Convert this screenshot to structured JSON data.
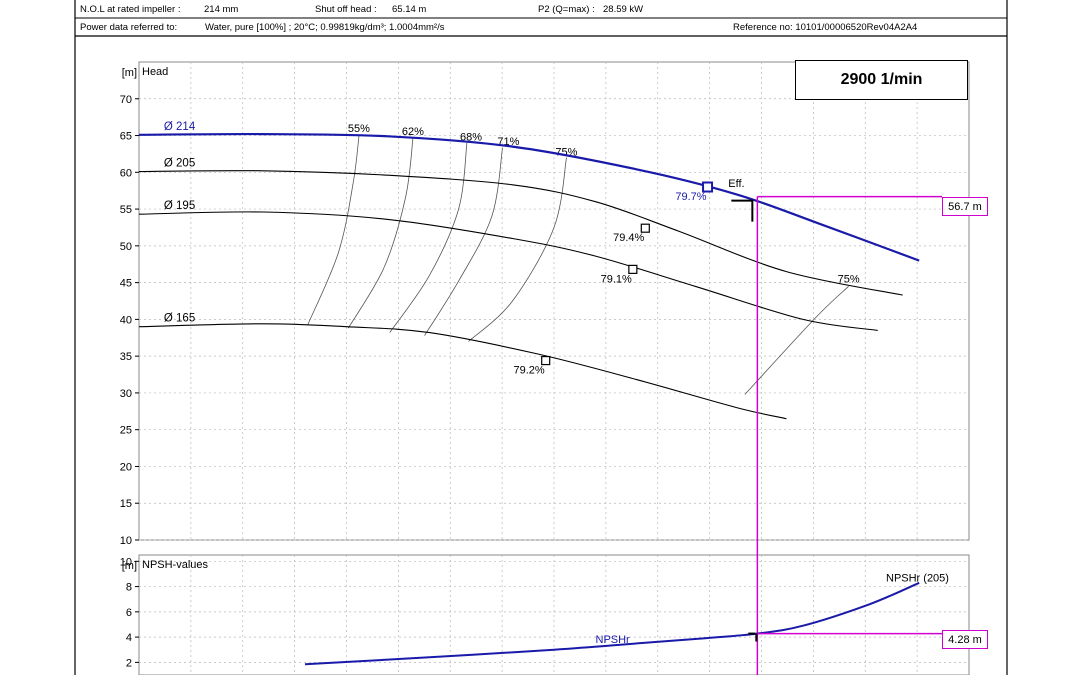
{
  "header": {
    "npol_label": "N.O.L at rated impeller :",
    "npol_value": "214 mm",
    "shutoff_label": "Shut off head :",
    "shutoff_value": "65.14 m",
    "p2_label": "P2 (Q=max) :",
    "p2_value": "28.59 kW",
    "power_label": "Power data referred to:",
    "power_value": "Water, pure [100%] ; 20°C; 0.99819kg/dm³; 1.0004mm²/s",
    "reference": "Reference no: 10101/00006520Rev04A2A4"
  },
  "speed_label": "2900 1/min",
  "callouts": {
    "head": "56.7 m",
    "npsh": "4.28 m"
  },
  "colors": {
    "operating_curve": "#1a1aaa",
    "duty_lines": "#d000d0",
    "grid": "#b8b8b8",
    "curves": "#000000"
  },
  "chart_data": [
    {
      "type": "line",
      "title": "Head",
      "ylabel": "[m]",
      "ylim": [
        10,
        75
      ],
      "xlim": [
        0,
        100
      ],
      "yticks": [
        10,
        15,
        20,
        25,
        30,
        35,
        40,
        45,
        50,
        55,
        60,
        65,
        70
      ],
      "grid": true,
      "series": [
        {
          "name": "Ø 214",
          "highlight": true,
          "points": [
            [
              0,
              65.1
            ],
            [
              15,
              65.2
            ],
            [
              30,
              64.9
            ],
            [
              45,
              63.5
            ],
            [
              60,
              60.4
            ],
            [
              72,
              57.0
            ],
            [
              82,
              53.0
            ],
            [
              94,
              48.0
            ]
          ],
          "bep": [
            68.5,
            58.0
          ],
          "bep_label": "79.7%"
        },
        {
          "name": "Ø 205",
          "points": [
            [
              0,
              60.1
            ],
            [
              15,
              60.2
            ],
            [
              30,
              59.6
            ],
            [
              45,
              58.3
            ],
            [
              55,
              56.0
            ],
            [
              65,
              52.0
            ],
            [
              78,
              46.5
            ],
            [
              92,
              43.3
            ]
          ],
          "bep": [
            61,
            52.4
          ],
          "bep_label": "79.4%"
        },
        {
          "name": "Ø 195",
          "points": [
            [
              0,
              54.3
            ],
            [
              15,
              54.6
            ],
            [
              30,
              53.6
            ],
            [
              45,
              51.0
            ],
            [
              55,
              48.6
            ],
            [
              67,
              44.5
            ],
            [
              80,
              40.0
            ],
            [
              89,
              38.5
            ]
          ],
          "bep": [
            59.5,
            46.8
          ],
          "bep_label": "79.1%"
        },
        {
          "name": "Ø 165",
          "points": [
            [
              0,
              39.0
            ],
            [
              15,
              39.4
            ],
            [
              25,
              39.0
            ],
            [
              35,
              38.2
            ],
            [
              48,
              35.3
            ],
            [
              60,
              31.8
            ],
            [
              72,
              28.0
            ],
            [
              78,
              26.5
            ]
          ],
          "bep": [
            49,
            34.4
          ],
          "bep_label": "79.2%"
        }
      ],
      "efficiency_labels": [
        {
          "label": "55%",
          "at": [
            26.5,
            65.5
          ]
        },
        {
          "label": "62%",
          "at": [
            33,
            65.1
          ]
        },
        {
          "label": "68%",
          "at": [
            40,
            64.3
          ]
        },
        {
          "label": "71%",
          "at": [
            44.5,
            63.7
          ]
        },
        {
          "label": "75%",
          "at": [
            51.5,
            62.3
          ]
        },
        {
          "label": "75%",
          "at": [
            85.5,
            45.0
          ]
        }
      ],
      "efficiency_lines": [
        [
          [
            26.5,
            65.0
          ],
          [
            25.8,
            58.5
          ],
          [
            24,
            49
          ],
          [
            20.3,
            39.2
          ]
        ],
        [
          [
            33,
            64.6
          ],
          [
            32.1,
            56.5
          ],
          [
            29.5,
            47
          ],
          [
            25.2,
            38.8
          ]
        ],
        [
          [
            39.5,
            64.0
          ],
          [
            38.5,
            55
          ],
          [
            35,
            46
          ],
          [
            30.2,
            38.2
          ]
        ],
        [
          [
            43.8,
            63.3
          ],
          [
            42.5,
            54
          ],
          [
            38.5,
            45.2
          ],
          [
            34.4,
            37.8
          ]
        ],
        [
          [
            51.5,
            62.0
          ],
          [
            50,
            52.5
          ],
          [
            45,
            42.5
          ],
          [
            39.7,
            37.0
          ]
        ],
        [
          [
            85.5,
            44.5
          ],
          [
            81.5,
            40.2
          ],
          [
            73,
            29.8
          ]
        ]
      ],
      "annotations": [
        {
          "label": "Eff.",
          "at": [
            71,
            58.0
          ]
        }
      ],
      "duty_point": {
        "x": 74.5,
        "y": 56.7
      }
    },
    {
      "type": "line",
      "title": "NPSH-values",
      "ylabel": "[m]",
      "ylim": [
        1,
        10.5
      ],
      "yticks": [
        2,
        4,
        6,
        8,
        10
      ],
      "grid": true,
      "series": [
        {
          "name": "NPSHr",
          "label_right": "NPSHr (205)",
          "points": [
            [
              20,
              1.85
            ],
            [
              35,
              2.4
            ],
            [
              50,
              3.0
            ],
            [
              60,
              3.5
            ],
            [
              68,
              3.9
            ],
            [
              74.5,
              4.28
            ],
            [
              80,
              4.9
            ],
            [
              88,
              6.6
            ],
            [
              94,
              8.3
            ]
          ]
        }
      ],
      "duty_point": {
        "x": 74.5,
        "y": 4.28
      }
    }
  ]
}
